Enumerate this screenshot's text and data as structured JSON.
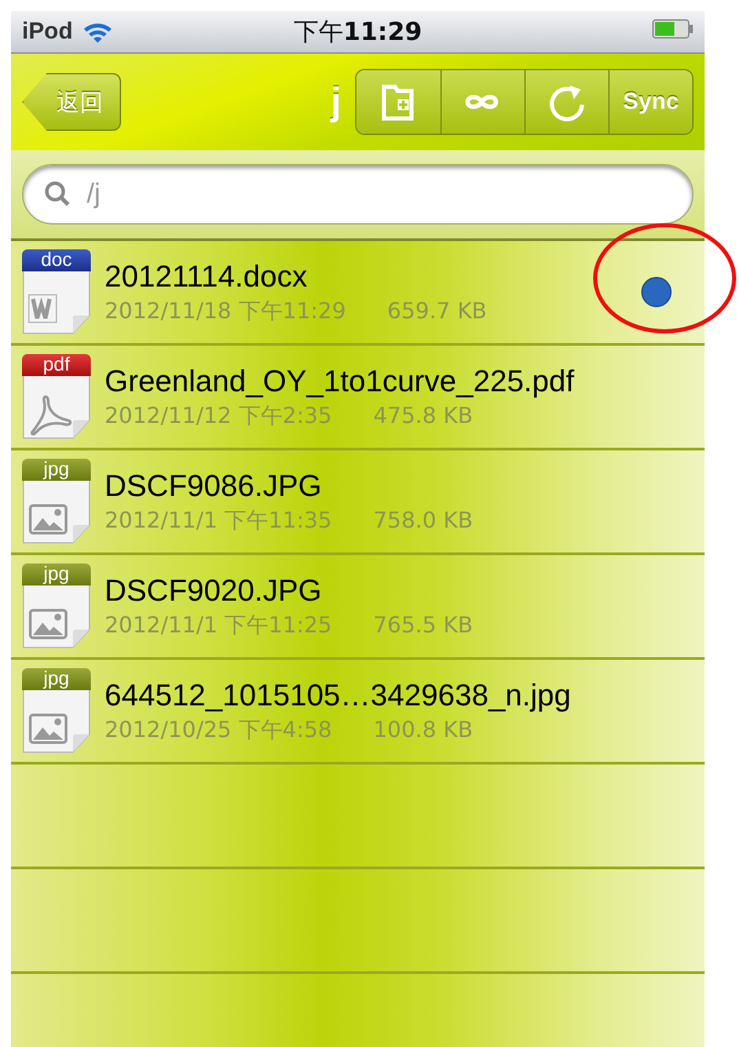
{
  "status_bar": {
    "device": "iPod",
    "time": "下午**11:29**"
  },
  "nav_bar": {
    "back": "返回",
    "title": "j",
    "sync": "Sync"
  },
  "search": {
    "placeholder": "/j"
  },
  "files": [
    {
      "kind": "doc",
      "type_label": "doc",
      "name": "20121114.docx",
      "date": "2012/11/18 下午11:29",
      "size": "659.7 KB",
      "marked": true
    },
    {
      "kind": "pdf",
      "type_label": "pdf",
      "name": "Greenland_OY_1to1curve_225.pdf",
      "date": "2012/11/12 下午2:35",
      "size": "475.8 KB",
      "marked": false
    },
    {
      "kind": "jpg",
      "type_label": "jpg",
      "name": "DSCF9086.JPG",
      "date": "2012/11/1 下午11:35",
      "size": "758.0 KB",
      "marked": false
    },
    {
      "kind": "jpg",
      "type_label": "jpg",
      "name": "DSCF9020.JPG",
      "date": "2012/11/1 下午11:25",
      "size": "765.5 KB",
      "marked": false
    },
    {
      "kind": "jpg",
      "type_label": "jpg",
      "name": "644512_1015105…3429638_n.jpg",
      "date": "2012/10/25 下午4:58",
      "size": "100.8 KB",
      "marked": false
    }
  ],
  "annotation": {
    "kind": "circle"
  }
}
